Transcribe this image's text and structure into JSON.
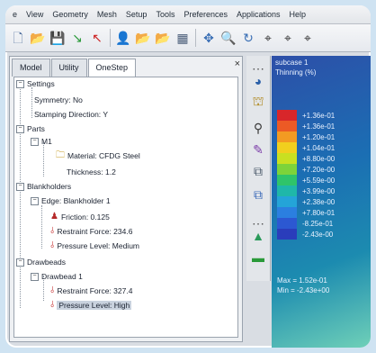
{
  "menu": [
    "e",
    "View",
    "Geometry",
    "Mesh",
    "Setup",
    "Tools",
    "Preferences",
    "Applications",
    "Help"
  ],
  "toolbar_icons": [
    "new-file-icon",
    "open-folder-icon",
    "save-icon",
    "arrow-green-icon",
    "arrow-red-icon",
    "person-icon",
    "open-folder-icon",
    "open-folder-icon",
    "grid-icon",
    "arrow-left-icon",
    "zoom-icon",
    "rotate-icon",
    "axis-icon",
    "axis-icon",
    "axis-icon"
  ],
  "tabs": [
    "Model",
    "Utility",
    "OneStep"
  ],
  "close_label": "×",
  "tree": {
    "settings": "Settings",
    "symmetry": "Symmetry: No",
    "stamping": "Stamping Direction: Y",
    "parts": "Parts",
    "m1": "M1",
    "material": "Material: CFDG Steel",
    "thickness": "Thickness: 1.2",
    "blankholders": "Blankholders",
    "edge": "Edge: Blankholder 1",
    "friction": "Friction: 0.125",
    "restraint1": "Restraint Force: 234.6",
    "pressure1": "Pressure Level: Medium",
    "drawbeads": "Drawbeads",
    "drawbead1": "Drawbead 1",
    "restraint2": "Restraint Force: 327.4",
    "pressure2": "Pressure Level: High"
  },
  "viewport": {
    "line1": "subcase   1",
    "line2": "Thinning (%)",
    "legend": [
      {
        "color": "#d8262a",
        "value": "+1.36e-01"
      },
      {
        "color": "#ec5a25",
        "value": "+1.36e-01"
      },
      {
        "color": "#f39a22",
        "value": "+1.20e-01"
      },
      {
        "color": "#f1cf1e",
        "value": "+1.04e-01"
      },
      {
        "color": "#c9e021",
        "value": "+8.80e-00"
      },
      {
        "color": "#7dd33a",
        "value": "+7.20e-00"
      },
      {
        "color": "#2fc46a",
        "value": "+5.59e-00"
      },
      {
        "color": "#1fb7a9",
        "value": "+3.99e-00"
      },
      {
        "color": "#24a4d8",
        "value": "+2.38e-00"
      },
      {
        "color": "#2b7fe0",
        "value": "+7.80e-01"
      },
      {
        "color": "#2c58d2",
        "value": "-8.25e-01"
      },
      {
        "color": "#2a3dbb",
        "value": "-2.43e-00"
      }
    ],
    "max": "Max = 1.52e-01",
    "min": "Min = -2.43e+00"
  }
}
